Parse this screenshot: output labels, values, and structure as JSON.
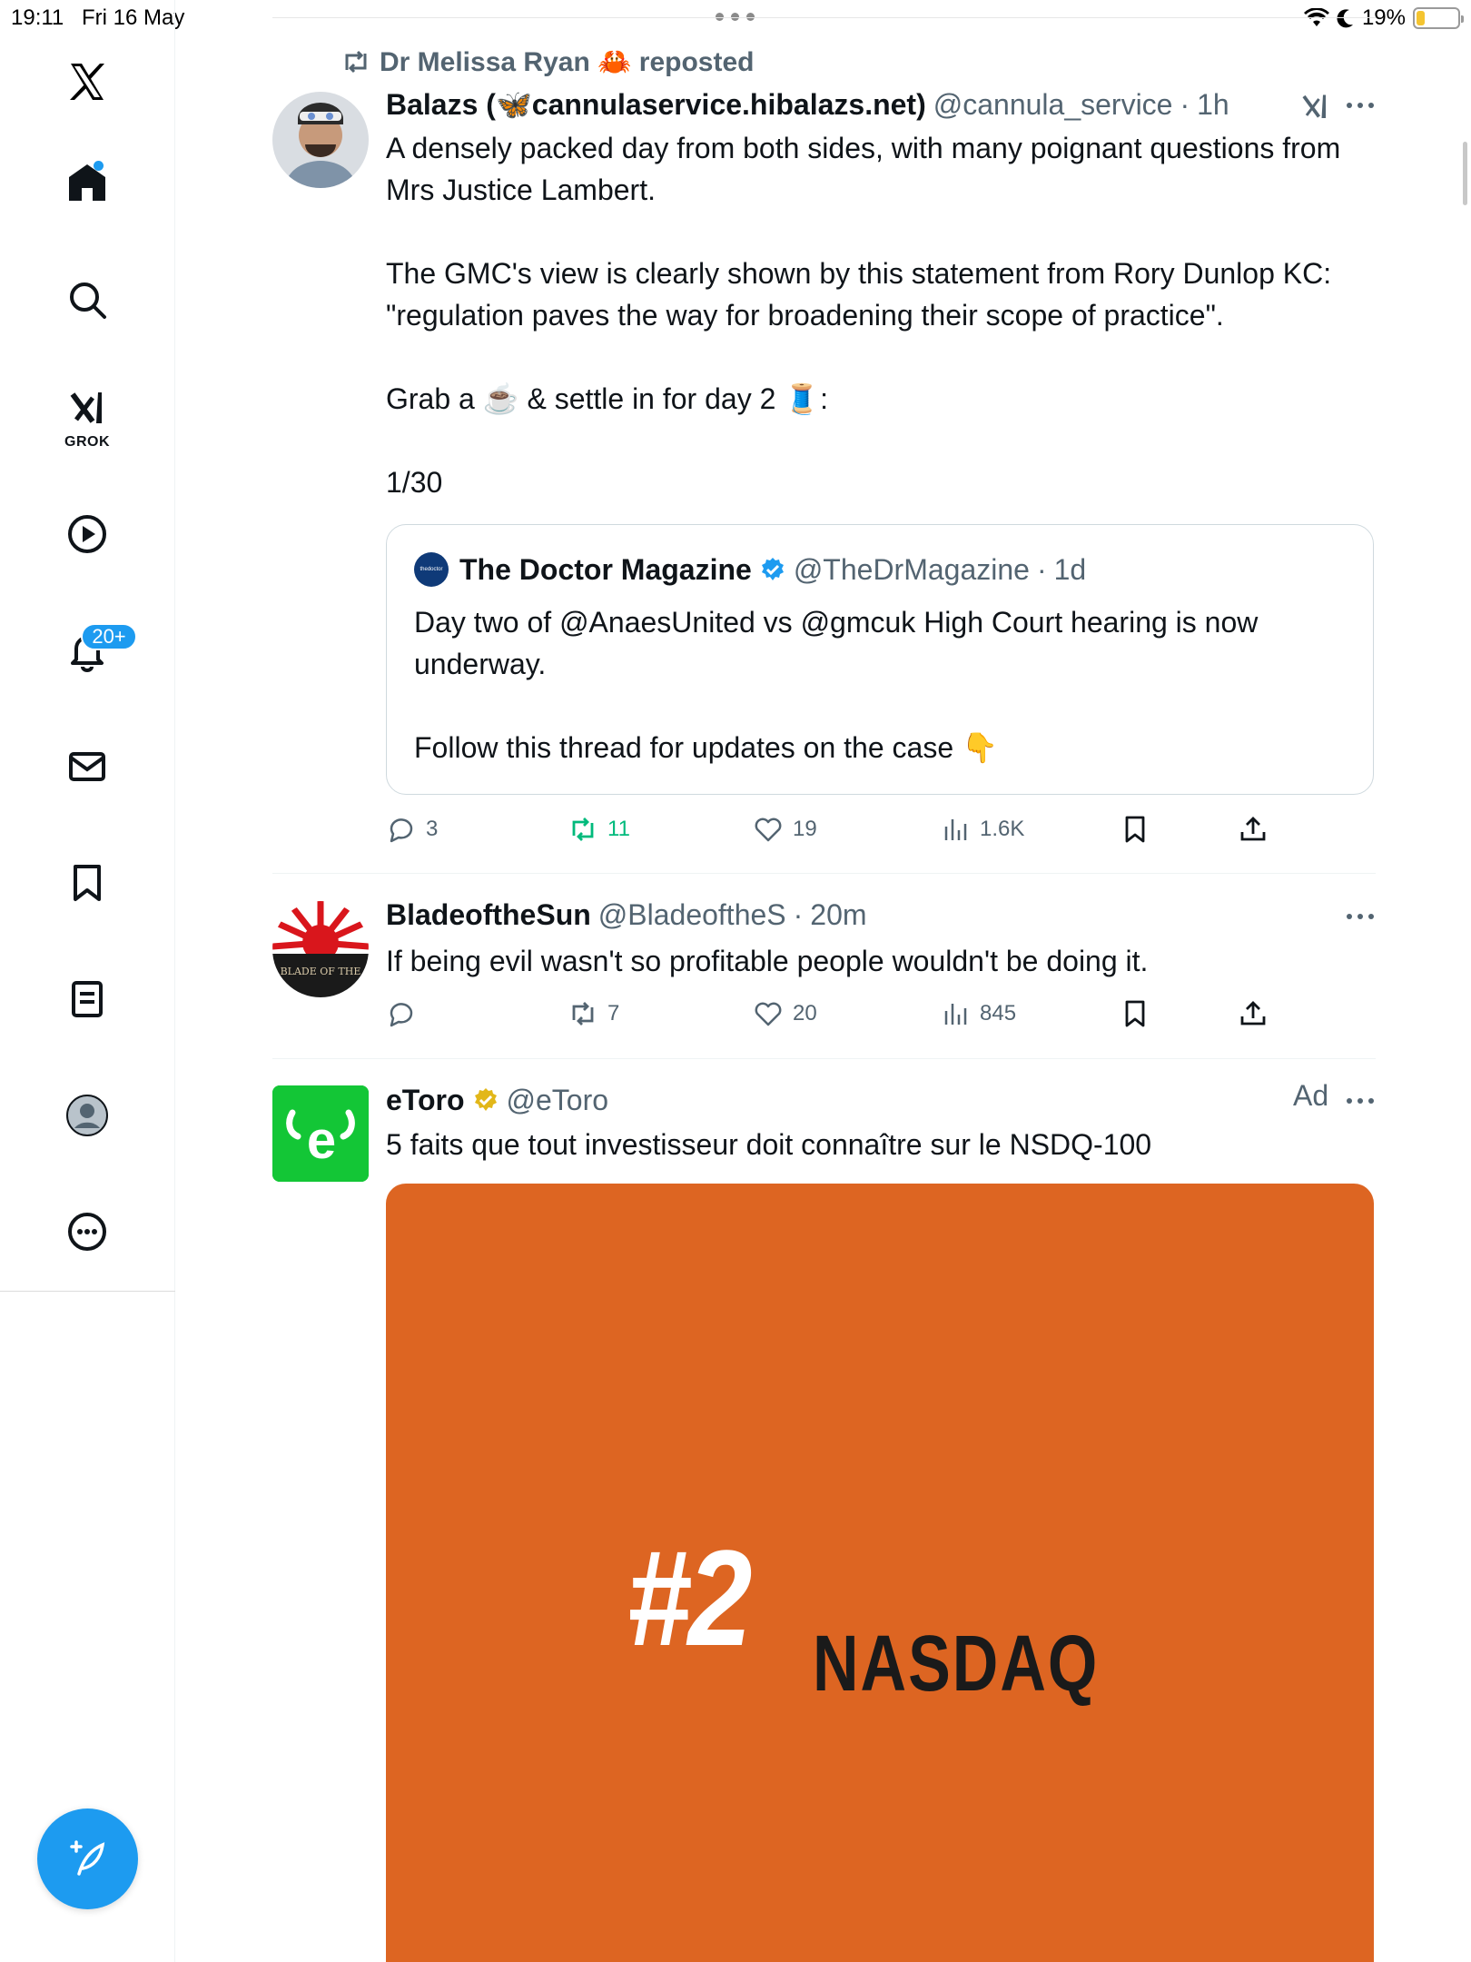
{
  "status_bar": {
    "time": "19:11",
    "date": "Fri 16 May",
    "battery": "19%",
    "battery_level": 0.19
  },
  "sidebar": {
    "grok_label": "GROK",
    "notifications_badge": "20+",
    "items": [
      "x-logo",
      "home",
      "search",
      "grok",
      "videos",
      "notifications",
      "messages",
      "bookmarks",
      "lists",
      "profile",
      "more"
    ]
  },
  "accent_color": "#1d9bf0",
  "tweets": [
    {
      "repost_by": "Dr Melissa Ryan 🦀 reposted",
      "name": "Balazs (🦋cannulaservice.hibalazs.net)",
      "handle": "@cannula_service",
      "time": "1h",
      "text": "A densely packed day from both sides, with many poignant questions from Mrs Justice Lambert.\n\nThe GMC's view is clearly shown by this statement from Rory Dunlop KC: \"regulation paves the way for broadening their scope of practice\".\n\nGrab a ☕ & settle in for day 2 🧵:\n\n1/30",
      "quote": {
        "avatar_text": "thedoctor",
        "name": "The Doctor Magazine",
        "handle": "@TheDrMagazine",
        "time": "1d",
        "text": "Day two of @AnaesUnited vs @gmcuk High Court hearing is now underway.\n\nFollow this thread for updates on the case 👇"
      },
      "stats": {
        "replies": "3",
        "reposts": "11",
        "likes": "19",
        "views": "1.6K"
      }
    },
    {
      "name": "BladeoftheSun",
      "handle": "@BladeoftheS",
      "time": "20m",
      "avatar_text": "BLADE OF THE",
      "text": "If being evil wasn't so profitable people wouldn't be doing it.",
      "stats": {
        "replies": "",
        "reposts": "7",
        "likes": "20",
        "views": "845"
      }
    },
    {
      "name": "eToro",
      "handle": "@eToro",
      "ad_label": "Ad",
      "text": "5 faits que tout investisseur doit connaître sur le NSDQ-100",
      "media": {
        "big_text": "#2",
        "word": "NASDAQ"
      }
    }
  ]
}
